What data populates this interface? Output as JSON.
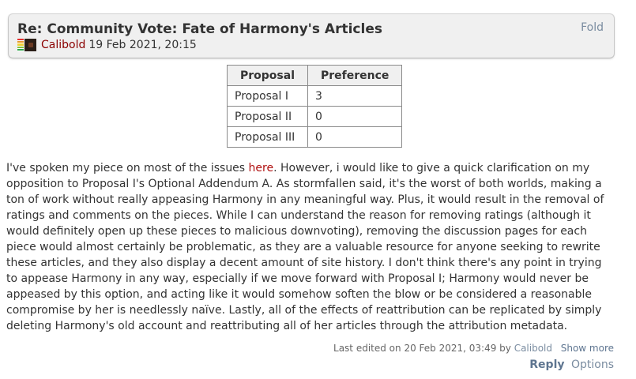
{
  "post": {
    "title": "Re: Community Vote: Fate of Harmony's Articles",
    "fold_label": "Fold",
    "author": "Calibold",
    "timestamp": "19 Feb 2021, 20:15",
    "icons": {
      "karma": "karma-bars-icon",
      "avatar": "avatar-icon"
    }
  },
  "table": {
    "headers": [
      "Proposal",
      "Preference"
    ],
    "rows": [
      [
        "Proposal I",
        "3"
      ],
      [
        "Proposal II",
        "0"
      ],
      [
        "Proposal III",
        "0"
      ]
    ]
  },
  "body": {
    "text_before_link": "I've spoken my piece on most of the issues ",
    "link_text": "here",
    "text_after_link": ". However, i would like to give a quick clarification on my opposition to Proposal I's Optional Addendum A. As stormfallen said, it's the worst of both worlds, making a ton of work without really appeasing Harmony in any meaningful way. Plus, it would result in the removal of ratings and comments on the pieces. While I can understand the reason for removing ratings (although it would definitely open up these pieces to malicious downvoting), removing the discussion pages for each piece would almost certainly be problematic, as they are a valuable resource for anyone seeking to rewrite these articles, and they also display a decent amount of site history. I don't think there's any point in trying to appease Harmony in any way, especially if we move forward with Proposal I; Harmony would never be appeased by this option, and acting like it would somehow soften the blow or be considered a reasonable compromise by her is needlessly naïve. Lastly, all of the effects of reattribution can be replicated by simply deleting Harmony's old account and reattributing all of her articles through the attribution metadata."
  },
  "footer": {
    "edited_prefix": "Last edited on 20 Feb 2021, 03:49 by ",
    "editor": "Calibold",
    "show_more": "Show more",
    "reply": "Reply",
    "options": "Options"
  },
  "colors": {
    "author": "#8b0000",
    "link": "#b01010",
    "action": "#5e7590",
    "karma_bars": [
      "#e53030",
      "#e89a2a",
      "#f0d13a",
      "#88c23a",
      "#2ea84a"
    ]
  }
}
